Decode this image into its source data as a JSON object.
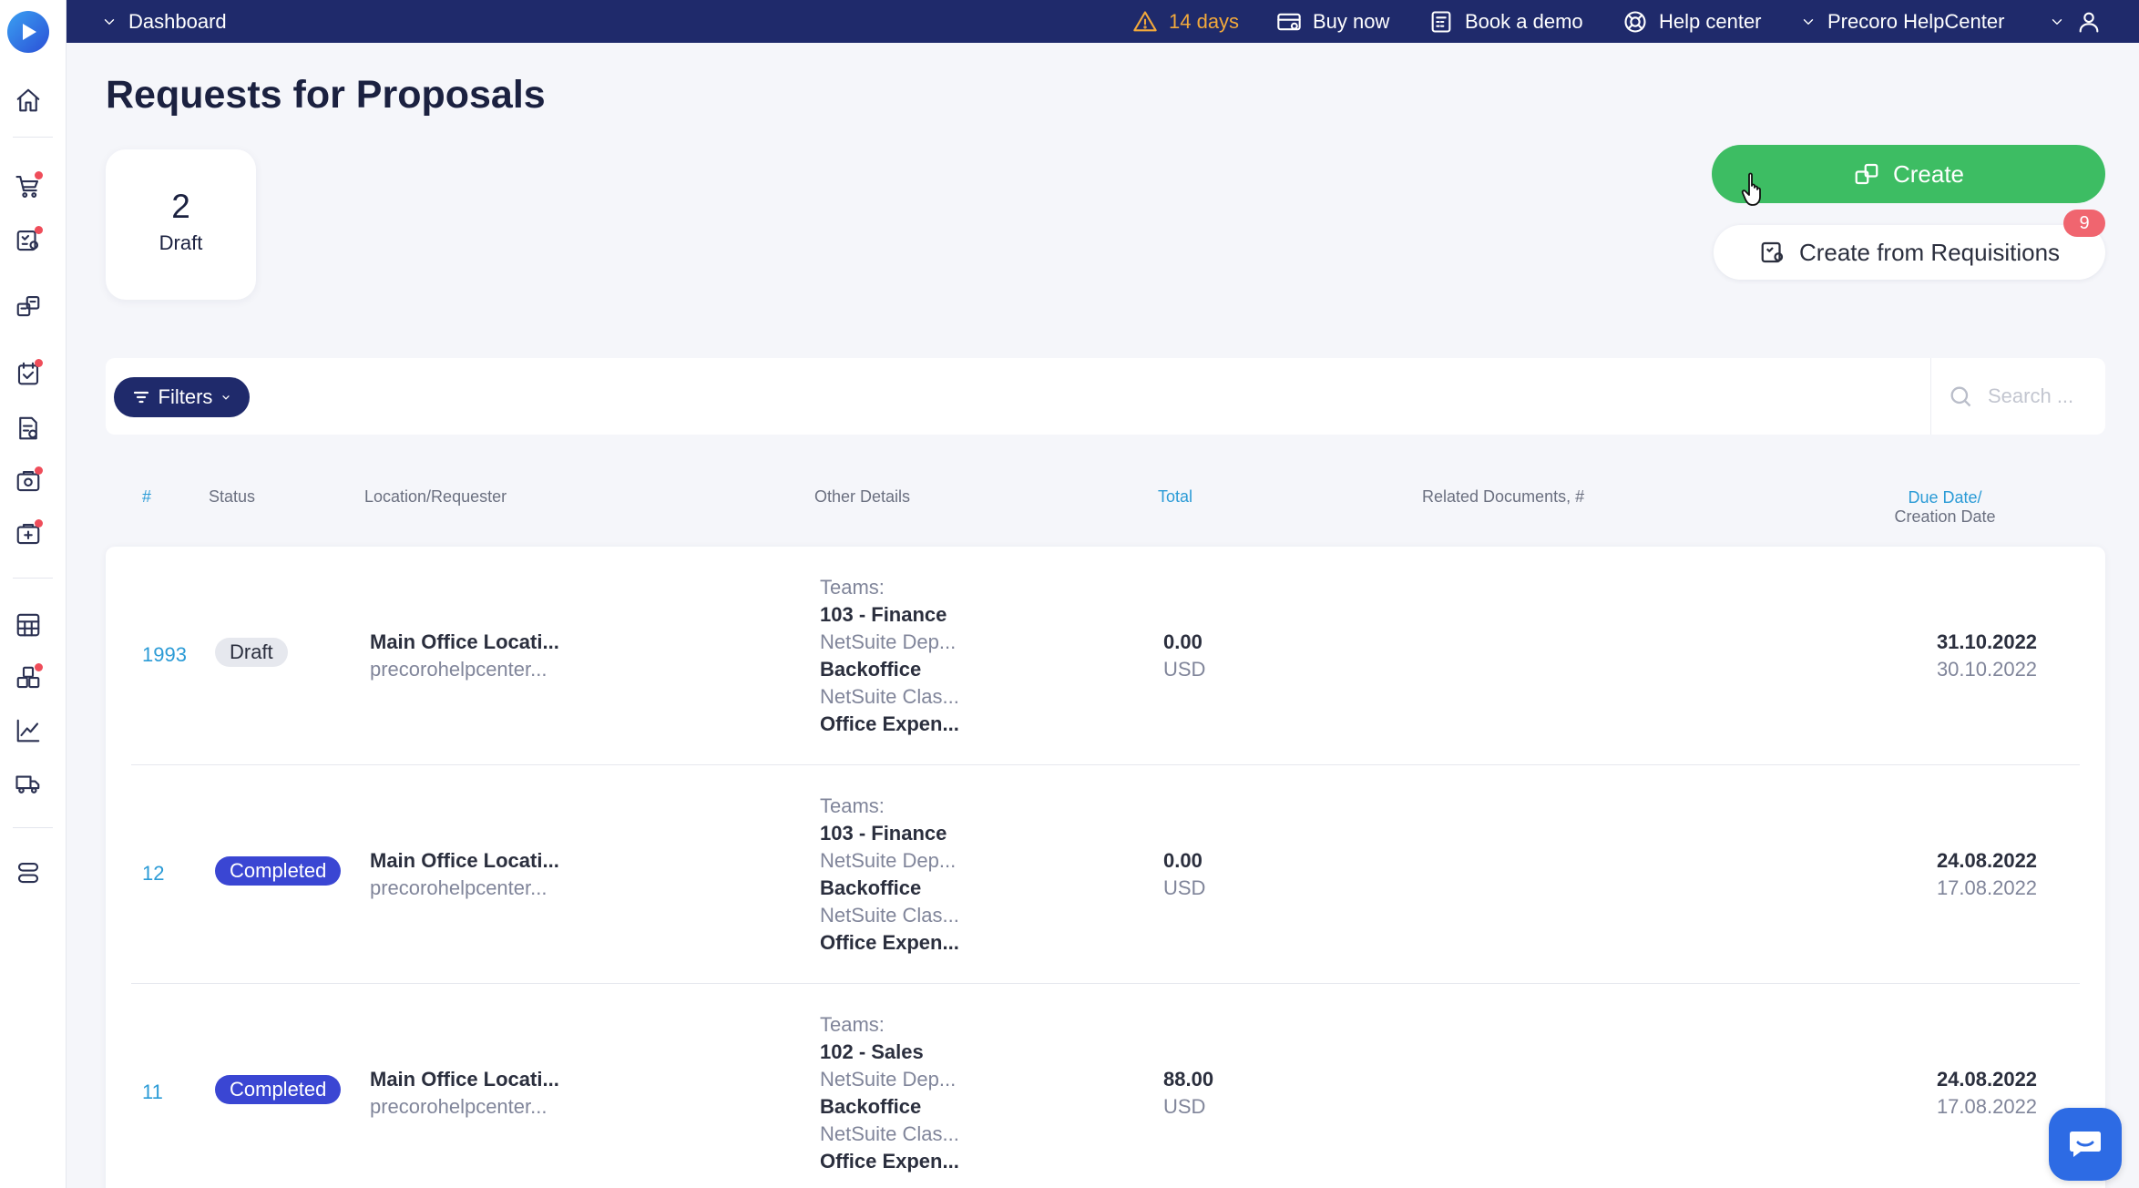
{
  "topbar": {
    "dashboard_label": "Dashboard",
    "trial_label": "14 days",
    "buy_label": "Buy now",
    "demo_label": "Book a demo",
    "help_label": "Help center",
    "company_label": "Precoro HelpCenter"
  },
  "page": {
    "title": "Requests for Proposals",
    "stat": {
      "count": "2",
      "label": "Draft"
    }
  },
  "actions": {
    "create_label": "Create",
    "create_from_req_label": "Create from Requisitions",
    "requisitions_count": "9"
  },
  "filters": {
    "label": "Filters",
    "search_placeholder": "Search ..."
  },
  "table": {
    "headers": {
      "id": "#",
      "status": "Status",
      "location": "Location/Requester",
      "details": "Other Details",
      "total": "Total",
      "related": "Related Documents, #",
      "due_date": "Due Date/",
      "creation_date": "Creation Date"
    },
    "rows": [
      {
        "id": "1993",
        "status": "Draft",
        "location": "Main Office Locati...",
        "requester": "precorohelpcenter...",
        "teams_label": "Teams:",
        "team": "103 - Finance",
        "dept_label": "NetSuite Dep...",
        "dept": "Backoffice",
        "class_label": "NetSuite Clas...",
        "class": "Office Expen...",
        "total": "0.00",
        "currency": "USD",
        "due": "31.10.2022",
        "created": "30.10.2022"
      },
      {
        "id": "12",
        "status": "Completed",
        "location": "Main Office Locati...",
        "requester": "precorohelpcenter...",
        "teams_label": "Teams:",
        "team": "103 - Finance",
        "dept_label": "NetSuite Dep...",
        "dept": "Backoffice",
        "class_label": "NetSuite Clas...",
        "class": "Office Expen...",
        "total": "0.00",
        "currency": "USD",
        "due": "24.08.2022",
        "created": "17.08.2022"
      },
      {
        "id": "11",
        "status": "Completed",
        "location": "Main Office Locati...",
        "requester": "precorohelpcenter...",
        "teams_label": "Teams:",
        "team": "102 - Sales",
        "dept_label": "NetSuite Dep...",
        "dept": "Backoffice",
        "class_label": "NetSuite Clas...",
        "class": "Office Expen...",
        "total": "88.00",
        "currency": "USD",
        "due": "24.08.2022",
        "created": "17.08.2022"
      }
    ]
  },
  "colors": {
    "topbar": "#1f2a6b",
    "create_button": "#3dbd63",
    "completed_badge": "#3a46d3",
    "link": "#2b9bd6",
    "trial_warning": "#f2a93b"
  }
}
